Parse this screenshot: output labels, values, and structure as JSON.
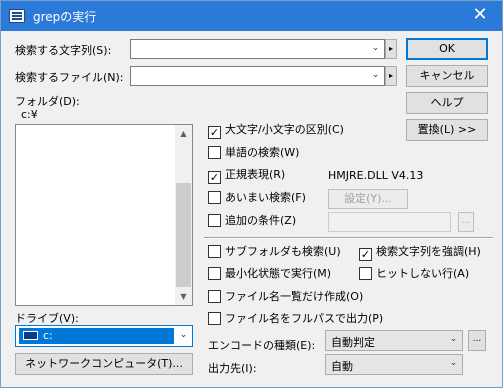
{
  "window": {
    "title": "grepの実行",
    "close_glyph": "✕"
  },
  "search_string": {
    "label": "検索する文字列(S):",
    "value": "",
    "arrow_glyph": "⌄",
    "side_glyph": "▸"
  },
  "search_file": {
    "label": "検索するファイル(N):",
    "value": "",
    "arrow_glyph": "⌄",
    "side_glyph": "▸"
  },
  "folder": {
    "label": "フォルダ(D):",
    "path": "c:¥"
  },
  "drive": {
    "label": "ドライブ(V):",
    "value": "c:",
    "arrow_glyph": "⌄"
  },
  "buttons": {
    "ok": "OK",
    "cancel": "キャンセル",
    "help": "ヘルプ",
    "replace": "置換(L) >>",
    "network": "ネットワークコンピュータ(T)...",
    "settings": "設定(Y)...",
    "extra": "...",
    "encoding_extra": "..."
  },
  "options": {
    "case_sensitive": {
      "label": "大文字/小文字の区別(C)",
      "checked": true
    },
    "word_search": {
      "label": "単語の検索(W)",
      "checked": false
    },
    "regex": {
      "label": "正規表現(R)",
      "checked": true
    },
    "fuzzy": {
      "label": "あいまい検索(F)",
      "checked": false
    },
    "extra_condition": {
      "label": "追加の条件(Z)",
      "checked": false
    },
    "subfolders": {
      "label": "サブフォルダも検索(U)",
      "checked": false
    },
    "highlight": {
      "label": "検索文字列を強調(H)",
      "checked": true
    },
    "minimize": {
      "label": "最小化状態で実行(M)",
      "checked": false
    },
    "non_matching": {
      "label": "ヒットしない行(A)",
      "checked": false
    },
    "file_list_only": {
      "label": "ファイル名一覧だけ作成(O)",
      "checked": false
    },
    "full_path": {
      "label": "ファイル名をフルパスで出力(P)",
      "checked": false
    }
  },
  "regex_lib": "HMJRE.DLL V4.13",
  "encoding": {
    "label": "エンコードの種類(E):",
    "value": "自動判定",
    "arrow_glyph": "⌄"
  },
  "output": {
    "label": "出力先(I):",
    "value": "自動",
    "arrow_glyph": "⌄"
  },
  "scrollbar": {
    "up_glyph": "▲",
    "down_glyph": "▼"
  },
  "check_glyph": "✓",
  "colors": {
    "titlebar": "#2b79d8",
    "accent": "#0078d7",
    "drive_highlight": "#0078d7"
  }
}
